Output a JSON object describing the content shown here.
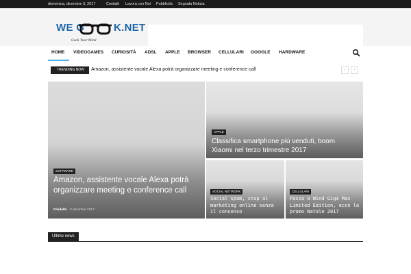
{
  "topbar": {
    "date": "domenica, dicembre 3, 2017",
    "links": [
      "Contatti",
      "Lavora con Noi",
      "Pubblicità",
      "Segnala Notizia"
    ]
  },
  "brand": {
    "logo_left": "WE G",
    "logo_right": "K.NET",
    "tagline": "Geek Your Mind",
    "color": "#1c66a8"
  },
  "nav": {
    "items": [
      "HOME",
      "VIDEOGAMES",
      "CURIOSITÀ",
      "ADSL",
      "APPLE",
      "BROWSER",
      "CELLULARI",
      "GOOGLE",
      "HARDWARE"
    ],
    "active_index": 0,
    "accent": "#4db2ec",
    "search_icon": "search-icon"
  },
  "trending": {
    "label": "TRENDING NOW",
    "headline": "Amazon, assistente vocale Alexa potrà organizzare meeting e conference call",
    "prev": "‹",
    "next": "›"
  },
  "tiles": {
    "main": {
      "category": "SOFTWARE",
      "title": "Amazon, assistente vocale Alexa potrà organizzare meeting e conference call",
      "author": "Filadelfo",
      "separator": " - ",
      "date": "3 dicembre 2017"
    },
    "top_right": {
      "category": "APPLE",
      "title": "Classifica smartphone più venduti, boom Xiaomi nel terzo trimestre 2017"
    },
    "bottom_left": {
      "category": "SOCIAL NETWORK",
      "title": "Social spam, stop al marketing online senza il consenso"
    },
    "bottom_right": {
      "category": "CELLULARI",
      "title": "Passa a Wind Giga Max Limited Edition, ecco la promo Natale 2017"
    }
  },
  "section": {
    "label": "Ultime news"
  }
}
